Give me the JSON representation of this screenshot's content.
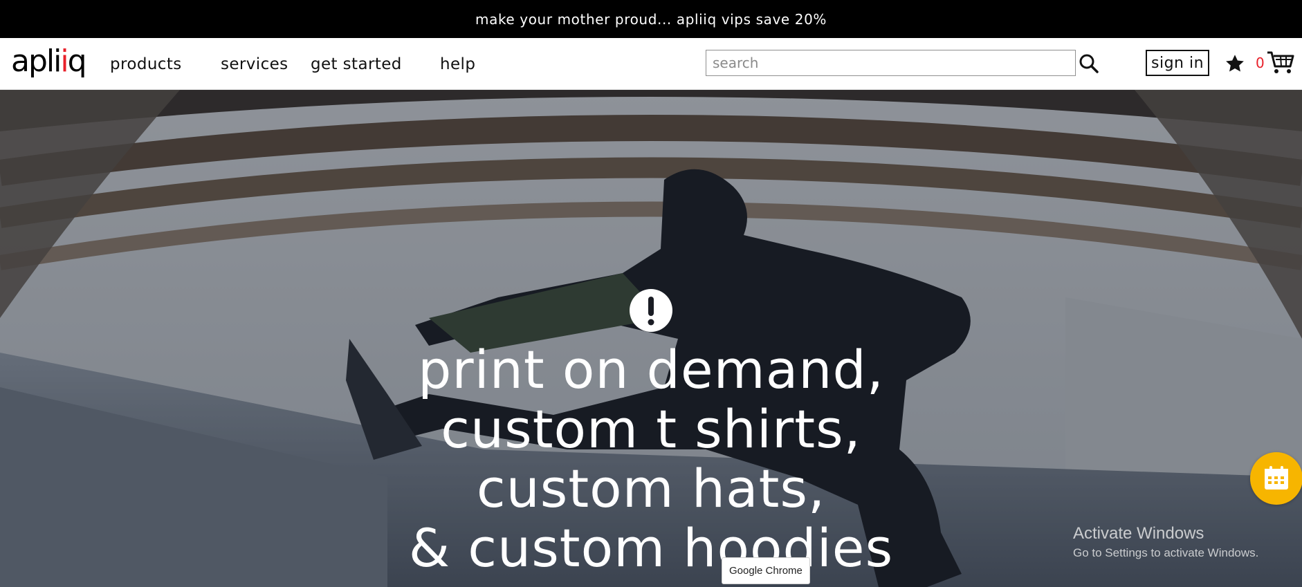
{
  "promo": {
    "text": "make your mother proud... apliiq vips save 20%"
  },
  "header": {
    "logo": {
      "text_main": "apli",
      "text_dot": "i",
      "text_end": "q"
    },
    "nav": [
      {
        "label": "products"
      },
      {
        "label": "services"
      },
      {
        "label": "get started"
      },
      {
        "label": "help"
      }
    ],
    "search": {
      "placeholder": "search",
      "value": ""
    },
    "signin_label": "sign in",
    "cart_count": "0",
    "icons": {
      "search": "search-icon",
      "favorites": "star-icon",
      "cart": "cart-icon"
    }
  },
  "hero": {
    "icon": "exclamation-icon",
    "headline": [
      "print on demand,",
      "custom t shirts,",
      "custom hats,",
      "& custom hoodies"
    ]
  },
  "widgets": {
    "calendar_icon": "calendar-icon",
    "calendar_color": "#f7b500"
  },
  "system_overlay": {
    "activate_title": "Activate Windows",
    "activate_sub": "Go to Settings to activate Windows.",
    "tooltip": "Google Chrome"
  },
  "colors": {
    "accent_red": "#e8202a",
    "promo_bg": "#000000",
    "text": "#111111"
  }
}
